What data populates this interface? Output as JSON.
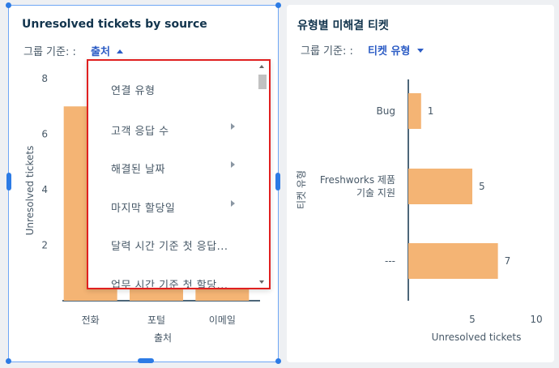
{
  "left_widget": {
    "title": "Unresolved tickets by source",
    "group_by_label": "그룹 기준: :",
    "group_by_value": "출처",
    "dropdown_items": [
      {
        "label": "연결 유형",
        "has_submenu": false
      },
      {
        "label": "고객 응답 수",
        "has_submenu": true
      },
      {
        "label": "해결된 날짜",
        "has_submenu": true
      },
      {
        "label": "마지막 할당일",
        "has_submenu": true
      },
      {
        "label": "달력 시간 기준 첫 응답...",
        "has_submenu": false
      },
      {
        "label": "업무 시간 기준 첫 할당...",
        "has_submenu": false
      }
    ]
  },
  "right_widget": {
    "title": "유형별 미해결 티켓",
    "group_by_label": "그룹 기준: :",
    "group_by_value": "티켓 유형"
  },
  "chart_data": [
    {
      "type": "bar",
      "orientation": "vertical",
      "categories": [
        "전화",
        "포털",
        "이메일"
      ],
      "values": [
        7,
        0.5,
        0.5
      ],
      "xlabel": "출처",
      "ylabel": "Unresolved tickets",
      "yticks": [
        "2",
        "4",
        "6",
        "8"
      ],
      "ylim": [
        0,
        8
      ],
      "bar_color": "#f4b474"
    },
    {
      "type": "bar",
      "orientation": "horizontal",
      "categories": [
        "Bug",
        "Freshworks 제품 기술 지원",
        "---"
      ],
      "category_lines": [
        [
          "Bug"
        ],
        [
          "Freshworks 제품",
          "기술 지원"
        ],
        [
          "---"
        ]
      ],
      "values": [
        1,
        5,
        7
      ],
      "data_labels": [
        "1",
        "5",
        "7"
      ],
      "xlabel": "Unresolved tickets",
      "ylabel": "티켓 유형",
      "xticks": [
        "5",
        "10"
      ],
      "xlim": [
        0,
        10
      ],
      "bar_color": "#f4b474"
    }
  ],
  "colors": {
    "accent": "#2c7be5",
    "highlight": "#e02020",
    "bar": "#f4b474"
  }
}
